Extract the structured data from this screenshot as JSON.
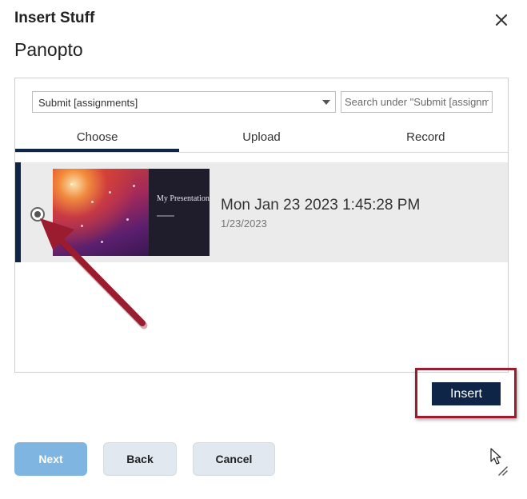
{
  "dialog": {
    "title": "Insert Stuff",
    "subtitle": "Panopto",
    "close_icon": "close-icon"
  },
  "toolbar": {
    "folder_value": "Submit [assignments]",
    "search_placeholder": "Search under \"Submit [assignm"
  },
  "tabs": [
    {
      "label": "Choose",
      "active": true
    },
    {
      "label": "Upload",
      "active": false
    },
    {
      "label": "Record",
      "active": false
    }
  ],
  "session": {
    "selected": true,
    "thumbnail_title": "My Presentation",
    "title": "Mon Jan 23 2023 1:45:28 PM",
    "date": "1/23/2023"
  },
  "actions": {
    "insert_label": "Insert"
  },
  "footer": {
    "next_label": "Next",
    "back_label": "Back",
    "cancel_label": "Cancel"
  },
  "colors": {
    "accent_navy": "#0f2547",
    "annotation_red": "#9b1b2f",
    "next_disabled": "#7fb6e1"
  }
}
